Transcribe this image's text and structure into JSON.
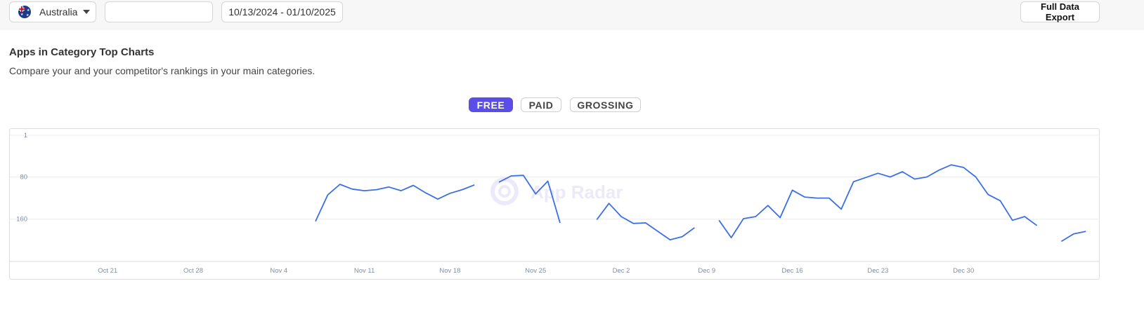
{
  "toolbar": {
    "country": "Australia",
    "search_value": "",
    "date_range": "10/13/2024 - 01/10/2025",
    "export_label": "Full Data Export"
  },
  "section": {
    "title": "Apps in Category Top Charts",
    "subtitle": "Compare your and your competitor's rankings in your main categories."
  },
  "segments": [
    {
      "label": "FREE",
      "active": true
    },
    {
      "label": "PAID",
      "active": false
    },
    {
      "label": "GROSSING",
      "active": false
    }
  ],
  "watermark": "App Radar",
  "colors": {
    "accent": "#5b4ee8",
    "line": "#3b6fe8"
  },
  "chart_data": {
    "type": "line",
    "title": "",
    "xlabel": "",
    "ylabel": "",
    "y_inverted": true,
    "ylim": [
      1,
      240
    ],
    "y_ticks": [
      1,
      80,
      160
    ],
    "grid": true,
    "x_start": "2024-10-13",
    "x_end": "2025-01-10",
    "x_ticks": [
      {
        "date": "2024-10-21",
        "label": "Oct 21"
      },
      {
        "date": "2024-10-28",
        "label": "Oct 28"
      },
      {
        "date": "2024-11-04",
        "label": "Nov 4"
      },
      {
        "date": "2024-11-11",
        "label": "Nov 11"
      },
      {
        "date": "2024-11-18",
        "label": "Nov 18"
      },
      {
        "date": "2024-11-25",
        "label": "Nov 25"
      },
      {
        "date": "2024-12-02",
        "label": "Dec 2"
      },
      {
        "date": "2024-12-09",
        "label": "Dec 9"
      },
      {
        "date": "2024-12-16",
        "label": "Dec 16"
      },
      {
        "date": "2024-12-23",
        "label": "Dec 23"
      },
      {
        "date": "2024-12-30",
        "label": "Dec 30"
      }
    ],
    "series": [
      {
        "segments": [
          [
            [
              "2024-11-07",
              164
            ],
            [
              "2024-11-08",
              114
            ],
            [
              "2024-11-09",
              94
            ],
            [
              "2024-11-10",
              103
            ],
            [
              "2024-11-11",
              106
            ],
            [
              "2024-11-12",
              104
            ],
            [
              "2024-11-13",
              99
            ],
            [
              "2024-11-14",
              106
            ],
            [
              "2024-11-15",
              96
            ],
            [
              "2024-11-16",
              110
            ],
            [
              "2024-11-17",
              122
            ],
            [
              "2024-11-18",
              111
            ],
            [
              "2024-11-19",
              104
            ],
            [
              "2024-11-20",
              95
            ]
          ],
          [
            [
              "2024-11-22",
              90
            ],
            [
              "2024-11-23",
              78
            ],
            [
              "2024-11-24",
              77
            ],
            [
              "2024-11-25",
              112
            ],
            [
              "2024-11-26",
              88
            ],
            [
              "2024-11-27",
              167
            ]
          ],
          [
            [
              "2024-11-30",
              161
            ],
            [
              "2024-12-01",
              130
            ],
            [
              "2024-12-02",
              155
            ],
            [
              "2024-12-03",
              168
            ],
            [
              "2024-12-04",
              167
            ],
            [
              "2024-12-05",
              183
            ],
            [
              "2024-12-06",
              199
            ],
            [
              "2024-12-07",
              193
            ],
            [
              "2024-12-08",
              176
            ]
          ],
          [
            [
              "2024-12-10",
              162
            ],
            [
              "2024-12-11",
              195
            ],
            [
              "2024-12-12",
              159
            ],
            [
              "2024-12-13",
              155
            ],
            [
              "2024-12-14",
              134
            ],
            [
              "2024-12-15",
              157
            ],
            [
              "2024-12-16",
              105
            ],
            [
              "2024-12-17",
              118
            ],
            [
              "2024-12-18",
              120
            ],
            [
              "2024-12-19",
              120
            ],
            [
              "2024-12-20",
              141
            ],
            [
              "2024-12-21",
              89
            ],
            [
              "2024-12-22",
              81
            ],
            [
              "2024-12-23",
              73
            ],
            [
              "2024-12-24",
              80
            ],
            [
              "2024-12-25",
              70
            ],
            [
              "2024-12-26",
              84
            ],
            [
              "2024-12-27",
              80
            ],
            [
              "2024-12-28",
              67
            ],
            [
              "2024-12-29",
              57
            ],
            [
              "2024-12-30",
              62
            ],
            [
              "2024-12-31",
              80
            ],
            [
              "2025-01-01",
              113
            ],
            [
              "2025-01-02",
              125
            ],
            [
              "2025-01-03",
              162
            ],
            [
              "2025-01-04",
              155
            ],
            [
              "2025-01-05",
              172
            ]
          ],
          [
            [
              "2025-01-07",
              202
            ],
            [
              "2025-01-08",
              188
            ],
            [
              "2025-01-09",
              183
            ]
          ]
        ]
      }
    ]
  }
}
